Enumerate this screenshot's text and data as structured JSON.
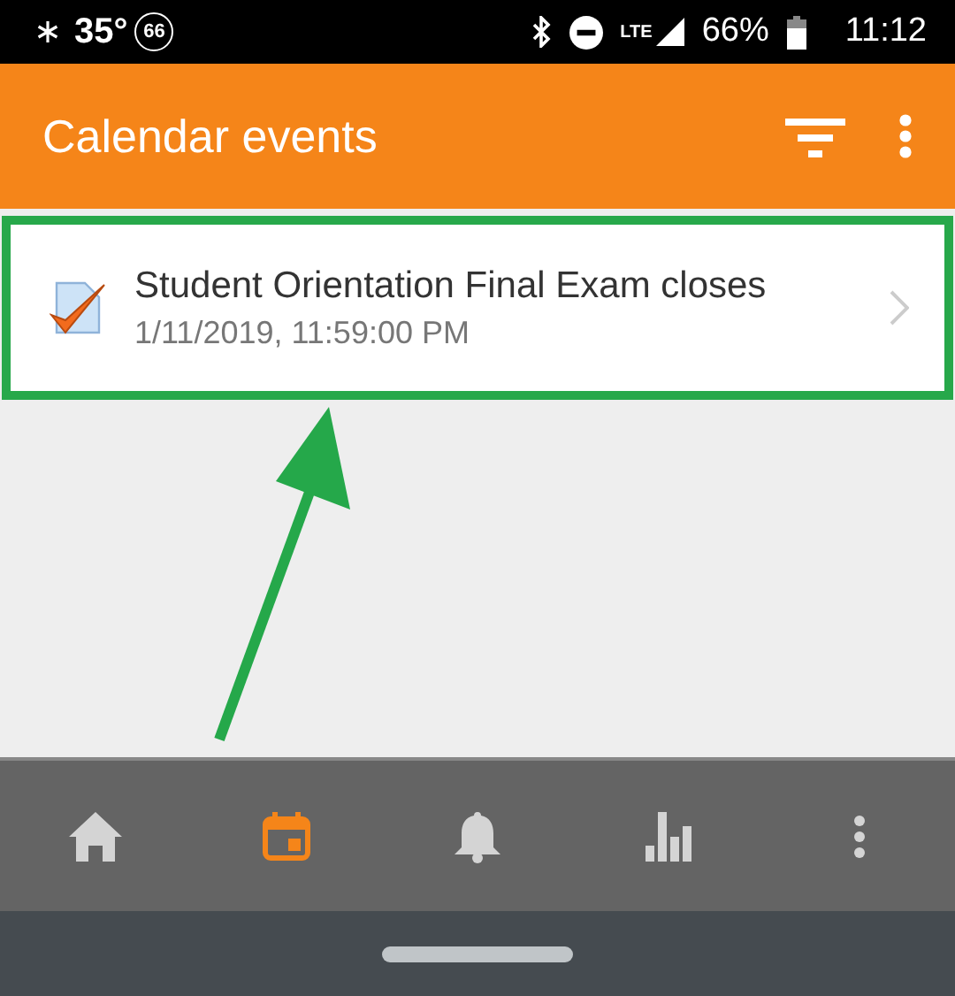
{
  "status_bar": {
    "temperature": "35°",
    "badge": "66",
    "network": "LTE",
    "battery": "66%",
    "time": "11:12"
  },
  "app_bar": {
    "title": "Calendar events"
  },
  "events": [
    {
      "title": "Student Orientation Final Exam closes",
      "date": "1/11/2019, 11:59:00 PM",
      "highlighted": true
    }
  ],
  "bottom_nav": [
    {
      "kind": "home",
      "selected": false
    },
    {
      "kind": "calendar",
      "selected": true
    },
    {
      "kind": "notifications",
      "selected": false
    },
    {
      "kind": "stats",
      "selected": false
    },
    {
      "kind": "more",
      "selected": false
    }
  ]
}
